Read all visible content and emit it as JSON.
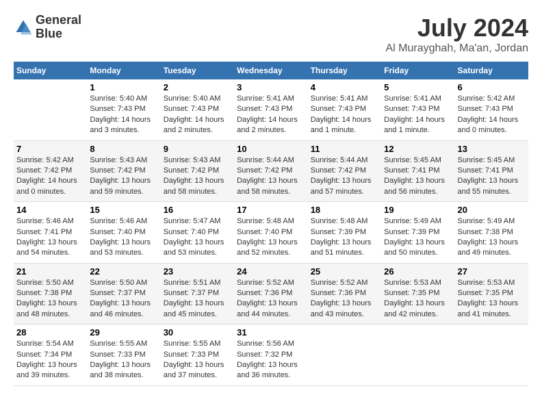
{
  "header": {
    "logo_line1": "General",
    "logo_line2": "Blue",
    "title": "July 2024",
    "subtitle": "Al Murayghah, Ma'an, Jordan"
  },
  "columns": [
    "Sunday",
    "Monday",
    "Tuesday",
    "Wednesday",
    "Thursday",
    "Friday",
    "Saturday"
  ],
  "weeks": [
    [
      {
        "day": "",
        "sunrise": "",
        "sunset": "",
        "daylight": ""
      },
      {
        "day": "1",
        "sunrise": "Sunrise: 5:40 AM",
        "sunset": "Sunset: 7:43 PM",
        "daylight": "Daylight: 14 hours and 3 minutes."
      },
      {
        "day": "2",
        "sunrise": "Sunrise: 5:40 AM",
        "sunset": "Sunset: 7:43 PM",
        "daylight": "Daylight: 14 hours and 2 minutes."
      },
      {
        "day": "3",
        "sunrise": "Sunrise: 5:41 AM",
        "sunset": "Sunset: 7:43 PM",
        "daylight": "Daylight: 14 hours and 2 minutes."
      },
      {
        "day": "4",
        "sunrise": "Sunrise: 5:41 AM",
        "sunset": "Sunset: 7:43 PM",
        "daylight": "Daylight: 14 hours and 1 minute."
      },
      {
        "day": "5",
        "sunrise": "Sunrise: 5:41 AM",
        "sunset": "Sunset: 7:43 PM",
        "daylight": "Daylight: 14 hours and 1 minute."
      },
      {
        "day": "6",
        "sunrise": "Sunrise: 5:42 AM",
        "sunset": "Sunset: 7:43 PM",
        "daylight": "Daylight: 14 hours and 0 minutes."
      }
    ],
    [
      {
        "day": "7",
        "sunrise": "Sunrise: 5:42 AM",
        "sunset": "Sunset: 7:42 PM",
        "daylight": "Daylight: 14 hours and 0 minutes."
      },
      {
        "day": "8",
        "sunrise": "Sunrise: 5:43 AM",
        "sunset": "Sunset: 7:42 PM",
        "daylight": "Daylight: 13 hours and 59 minutes."
      },
      {
        "day": "9",
        "sunrise": "Sunrise: 5:43 AM",
        "sunset": "Sunset: 7:42 PM",
        "daylight": "Daylight: 13 hours and 58 minutes."
      },
      {
        "day": "10",
        "sunrise": "Sunrise: 5:44 AM",
        "sunset": "Sunset: 7:42 PM",
        "daylight": "Daylight: 13 hours and 58 minutes."
      },
      {
        "day": "11",
        "sunrise": "Sunrise: 5:44 AM",
        "sunset": "Sunset: 7:42 PM",
        "daylight": "Daylight: 13 hours and 57 minutes."
      },
      {
        "day": "12",
        "sunrise": "Sunrise: 5:45 AM",
        "sunset": "Sunset: 7:41 PM",
        "daylight": "Daylight: 13 hours and 56 minutes."
      },
      {
        "day": "13",
        "sunrise": "Sunrise: 5:45 AM",
        "sunset": "Sunset: 7:41 PM",
        "daylight": "Daylight: 13 hours and 55 minutes."
      }
    ],
    [
      {
        "day": "14",
        "sunrise": "Sunrise: 5:46 AM",
        "sunset": "Sunset: 7:41 PM",
        "daylight": "Daylight: 13 hours and 54 minutes."
      },
      {
        "day": "15",
        "sunrise": "Sunrise: 5:46 AM",
        "sunset": "Sunset: 7:40 PM",
        "daylight": "Daylight: 13 hours and 53 minutes."
      },
      {
        "day": "16",
        "sunrise": "Sunrise: 5:47 AM",
        "sunset": "Sunset: 7:40 PM",
        "daylight": "Daylight: 13 hours and 53 minutes."
      },
      {
        "day": "17",
        "sunrise": "Sunrise: 5:48 AM",
        "sunset": "Sunset: 7:40 PM",
        "daylight": "Daylight: 13 hours and 52 minutes."
      },
      {
        "day": "18",
        "sunrise": "Sunrise: 5:48 AM",
        "sunset": "Sunset: 7:39 PM",
        "daylight": "Daylight: 13 hours and 51 minutes."
      },
      {
        "day": "19",
        "sunrise": "Sunrise: 5:49 AM",
        "sunset": "Sunset: 7:39 PM",
        "daylight": "Daylight: 13 hours and 50 minutes."
      },
      {
        "day": "20",
        "sunrise": "Sunrise: 5:49 AM",
        "sunset": "Sunset: 7:38 PM",
        "daylight": "Daylight: 13 hours and 49 minutes."
      }
    ],
    [
      {
        "day": "21",
        "sunrise": "Sunrise: 5:50 AM",
        "sunset": "Sunset: 7:38 PM",
        "daylight": "Daylight: 13 hours and 48 minutes."
      },
      {
        "day": "22",
        "sunrise": "Sunrise: 5:50 AM",
        "sunset": "Sunset: 7:37 PM",
        "daylight": "Daylight: 13 hours and 46 minutes."
      },
      {
        "day": "23",
        "sunrise": "Sunrise: 5:51 AM",
        "sunset": "Sunset: 7:37 PM",
        "daylight": "Daylight: 13 hours and 45 minutes."
      },
      {
        "day": "24",
        "sunrise": "Sunrise: 5:52 AM",
        "sunset": "Sunset: 7:36 PM",
        "daylight": "Daylight: 13 hours and 44 minutes."
      },
      {
        "day": "25",
        "sunrise": "Sunrise: 5:52 AM",
        "sunset": "Sunset: 7:36 PM",
        "daylight": "Daylight: 13 hours and 43 minutes."
      },
      {
        "day": "26",
        "sunrise": "Sunrise: 5:53 AM",
        "sunset": "Sunset: 7:35 PM",
        "daylight": "Daylight: 13 hours and 42 minutes."
      },
      {
        "day": "27",
        "sunrise": "Sunrise: 5:53 AM",
        "sunset": "Sunset: 7:35 PM",
        "daylight": "Daylight: 13 hours and 41 minutes."
      }
    ],
    [
      {
        "day": "28",
        "sunrise": "Sunrise: 5:54 AM",
        "sunset": "Sunset: 7:34 PM",
        "daylight": "Daylight: 13 hours and 39 minutes."
      },
      {
        "day": "29",
        "sunrise": "Sunrise: 5:55 AM",
        "sunset": "Sunset: 7:33 PM",
        "daylight": "Daylight: 13 hours and 38 minutes."
      },
      {
        "day": "30",
        "sunrise": "Sunrise: 5:55 AM",
        "sunset": "Sunset: 7:33 PM",
        "daylight": "Daylight: 13 hours and 37 minutes."
      },
      {
        "day": "31",
        "sunrise": "Sunrise: 5:56 AM",
        "sunset": "Sunset: 7:32 PM",
        "daylight": "Daylight: 13 hours and 36 minutes."
      },
      {
        "day": "",
        "sunrise": "",
        "sunset": "",
        "daylight": ""
      },
      {
        "day": "",
        "sunrise": "",
        "sunset": "",
        "daylight": ""
      },
      {
        "day": "",
        "sunrise": "",
        "sunset": "",
        "daylight": ""
      }
    ]
  ]
}
